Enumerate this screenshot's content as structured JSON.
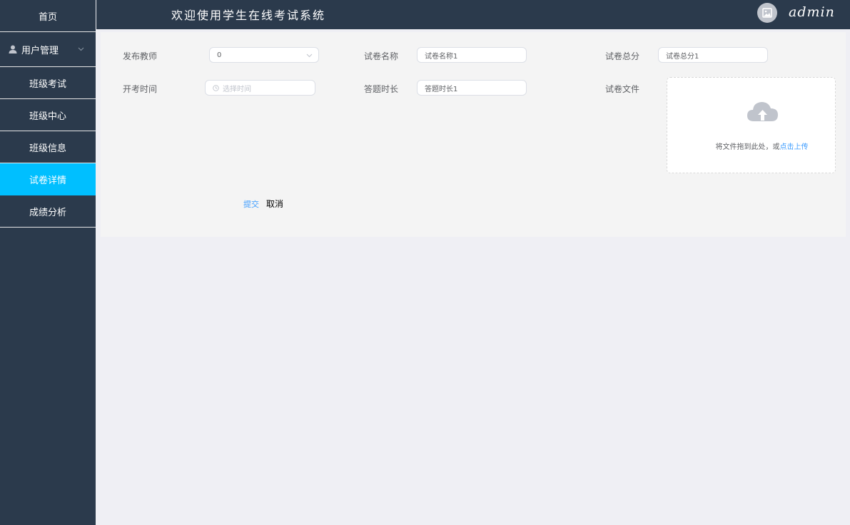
{
  "header": {
    "welcome": "欢迎使用学生在线考试系统",
    "username": "admin"
  },
  "sidebar": {
    "items": [
      {
        "label": "首页"
      },
      {
        "label": "用户管理"
      },
      {
        "label": "班级考试"
      },
      {
        "label": "班级中心"
      },
      {
        "label": "班级信息"
      },
      {
        "label": "试卷详情"
      },
      {
        "label": "成绩分析"
      }
    ],
    "active": "试卷详情"
  },
  "form": {
    "teacher_label": "发布教师",
    "teacher_value": "0",
    "paper_name_label": "试卷名称",
    "paper_name_value": "试卷名称1",
    "total_score_label": "试卷总分",
    "total_score_value": "试卷总分1",
    "start_time_label": "开考时间",
    "start_time_placeholder": "选择时间",
    "duration_label": "答题时长",
    "duration_value": "答题时长1",
    "file_label": "试卷文件",
    "upload_text": "将文件拖到此处，或",
    "upload_link": "点击上传",
    "submit_label": "提交",
    "cancel_label": "取消"
  },
  "colors": {
    "sidebar_bg": "#2b3a4c",
    "active_bg": "#00bfff",
    "link": "#409eff"
  }
}
